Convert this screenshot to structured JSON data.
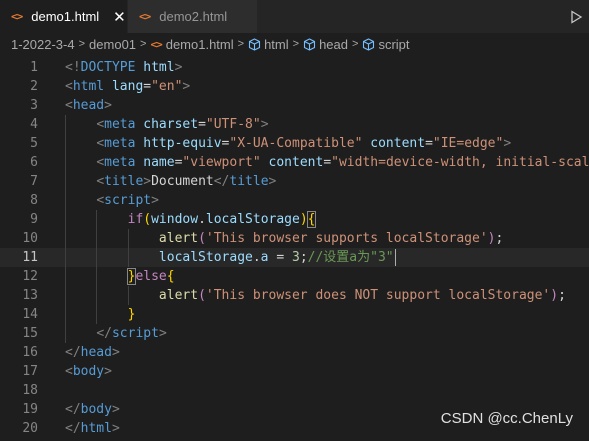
{
  "tabs": [
    {
      "icon": "<>",
      "label": "demo1.html",
      "close": "✕"
    },
    {
      "icon": "<>",
      "label": "demo2.html"
    }
  ],
  "breadcrumb": {
    "path": [
      "1-2022-3-4",
      "demo01"
    ],
    "file": "demo1.html",
    "symbols": [
      "html",
      "head",
      "script"
    ]
  },
  "editor": {
    "line_numbers": [
      "1",
      "2",
      "3",
      "4",
      "5",
      "6",
      "7",
      "8",
      "9",
      "10",
      "11",
      "12",
      "13",
      "14",
      "15",
      "16",
      "17",
      "18",
      "19",
      "20"
    ],
    "current_line": "11",
    "lines": [
      [
        {
          "t": "<!",
          "c": "punc"
        },
        {
          "t": "DOCTYPE",
          "c": "tag"
        },
        {
          "t": " html",
          "c": "attr"
        },
        {
          "t": ">",
          "c": "punc"
        }
      ],
      [
        {
          "t": "<",
          "c": "punc"
        },
        {
          "t": "html",
          "c": "tag"
        },
        {
          "t": " lang",
          "c": "attr"
        },
        {
          "t": "=",
          "c": "txt"
        },
        {
          "t": "\"en\"",
          "c": "str"
        },
        {
          "t": ">",
          "c": "punc"
        }
      ],
      [
        {
          "t": "<",
          "c": "punc"
        },
        {
          "t": "head",
          "c": "tag"
        },
        {
          "t": ">",
          "c": "punc"
        }
      ],
      [
        {
          "t": "    ",
          "c": "txt"
        },
        {
          "t": "<",
          "c": "punc"
        },
        {
          "t": "meta",
          "c": "tag"
        },
        {
          "t": " charset",
          "c": "attr"
        },
        {
          "t": "=",
          "c": "txt"
        },
        {
          "t": "\"UTF-8\"",
          "c": "str"
        },
        {
          "t": ">",
          "c": "punc"
        }
      ],
      [
        {
          "t": "    ",
          "c": "txt"
        },
        {
          "t": "<",
          "c": "punc"
        },
        {
          "t": "meta",
          "c": "tag"
        },
        {
          "t": " http-equiv",
          "c": "attr"
        },
        {
          "t": "=",
          "c": "txt"
        },
        {
          "t": "\"X-UA-Compatible\"",
          "c": "str"
        },
        {
          "t": " content",
          "c": "attr"
        },
        {
          "t": "=",
          "c": "txt"
        },
        {
          "t": "\"IE=edge\"",
          "c": "str"
        },
        {
          "t": ">",
          "c": "punc"
        }
      ],
      [
        {
          "t": "    ",
          "c": "txt"
        },
        {
          "t": "<",
          "c": "punc"
        },
        {
          "t": "meta",
          "c": "tag"
        },
        {
          "t": " name",
          "c": "attr"
        },
        {
          "t": "=",
          "c": "txt"
        },
        {
          "t": "\"viewport\"",
          "c": "str"
        },
        {
          "t": " content",
          "c": "attr"
        },
        {
          "t": "=",
          "c": "txt"
        },
        {
          "t": "\"width=device-width, initial-scal",
          "c": "str"
        }
      ],
      [
        {
          "t": "    ",
          "c": "txt"
        },
        {
          "t": "<",
          "c": "punc"
        },
        {
          "t": "title",
          "c": "tag"
        },
        {
          "t": ">",
          "c": "punc"
        },
        {
          "t": "Document",
          "c": "txt"
        },
        {
          "t": "</",
          "c": "punc"
        },
        {
          "t": "title",
          "c": "tag"
        },
        {
          "t": ">",
          "c": "punc"
        }
      ],
      [
        {
          "t": "    ",
          "c": "txt"
        },
        {
          "t": "<",
          "c": "punc"
        },
        {
          "t": "script",
          "c": "tag"
        },
        {
          "t": ">",
          "c": "punc"
        }
      ],
      [
        {
          "t": "        ",
          "c": "txt"
        },
        {
          "t": "if",
          "c": "kw"
        },
        {
          "t": "(",
          "c": "brk"
        },
        {
          "t": "window",
          "c": "var"
        },
        {
          "t": ".",
          "c": "txt"
        },
        {
          "t": "localStorage",
          "c": "var"
        },
        {
          "t": ")",
          "c": "brk"
        },
        {
          "t": "{",
          "c": "brk-match"
        }
      ],
      [
        {
          "t": "            ",
          "c": "txt"
        },
        {
          "t": "alert",
          "c": "fn"
        },
        {
          "t": "(",
          "c": "kw"
        },
        {
          "t": "'This browser supports localStorage'",
          "c": "str"
        },
        {
          "t": ")",
          "c": "kw"
        },
        {
          "t": ";",
          "c": "txt"
        }
      ],
      [
        {
          "t": "            ",
          "c": "txt"
        },
        {
          "t": "localStorage",
          "c": "var"
        },
        {
          "t": ".",
          "c": "txt"
        },
        {
          "t": "a",
          "c": "var"
        },
        {
          "t": " = ",
          "c": "txt"
        },
        {
          "t": "3",
          "c": "num"
        },
        {
          "t": ";",
          "c": "txt"
        },
        {
          "t": "//设置a为\"3\"",
          "c": "cmt"
        }
      ],
      [
        {
          "t": "        ",
          "c": "txt"
        },
        {
          "t": "}",
          "c": "brk-match"
        },
        {
          "t": "else",
          "c": "kw"
        },
        {
          "t": "{",
          "c": "brk"
        }
      ],
      [
        {
          "t": "            ",
          "c": "txt"
        },
        {
          "t": "alert",
          "c": "fn"
        },
        {
          "t": "(",
          "c": "kw"
        },
        {
          "t": "'This browser does NOT support localStorage'",
          "c": "str"
        },
        {
          "t": ")",
          "c": "kw"
        },
        {
          "t": ";",
          "c": "txt"
        }
      ],
      [
        {
          "t": "        ",
          "c": "txt"
        },
        {
          "t": "}",
          "c": "brk"
        }
      ],
      [
        {
          "t": "    ",
          "c": "txt"
        },
        {
          "t": "</",
          "c": "punc"
        },
        {
          "t": "script",
          "c": "tag"
        },
        {
          "t": ">",
          "c": "punc"
        }
      ],
      [
        {
          "t": "</",
          "c": "punc"
        },
        {
          "t": "head",
          "c": "tag"
        },
        {
          "t": ">",
          "c": "punc"
        }
      ],
      [
        {
          "t": "<",
          "c": "punc"
        },
        {
          "t": "body",
          "c": "tag"
        },
        {
          "t": ">",
          "c": "punc"
        }
      ],
      [],
      [
        {
          "t": "</",
          "c": "punc"
        },
        {
          "t": "body",
          "c": "tag"
        },
        {
          "t": ">",
          "c": "punc"
        }
      ],
      [
        {
          "t": "</",
          "c": "punc"
        },
        {
          "t": "html",
          "c": "tag"
        },
        {
          "t": ">",
          "c": "punc"
        }
      ]
    ]
  },
  "watermark": "CSDN @cc.ChenLy",
  "colors": {
    "editor_bg": "#1e1e1e",
    "tabbar_bg": "#252526",
    "html_icon": "#e37933",
    "tag": "#569cd6",
    "attribute": "#9cdcfe",
    "string": "#ce9178",
    "keyword": "#c586c0",
    "function": "#dcdcaa",
    "number": "#b5cea8",
    "comment": "#6a9955",
    "bracket": "#ffd700"
  }
}
